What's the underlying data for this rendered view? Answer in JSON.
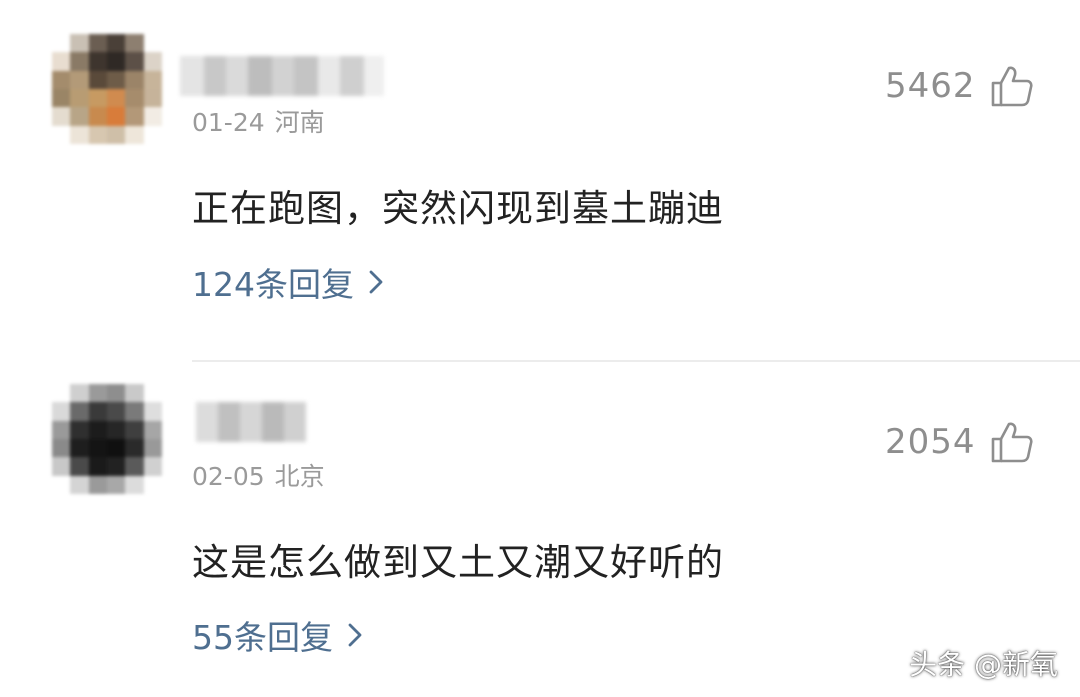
{
  "comments": [
    {
      "date": "01-24",
      "location": "河南",
      "likes": "5462",
      "text": "正在跑图，突然闪现到墓土蹦迪",
      "replies": "124条回复"
    },
    {
      "date": "02-05",
      "location": "北京",
      "likes": "2054",
      "text": "这是怎么做到又土又潮又好听的",
      "replies": "55条回复"
    }
  ],
  "icons": {
    "like": "thumbs-up-icon",
    "reply_arrow": "chevron-right-icon"
  },
  "colors": {
    "reply_link": "#4f6f90",
    "meta_gray": "#9a9a9a",
    "text": "#222222"
  },
  "watermark": "头条 @新氧"
}
